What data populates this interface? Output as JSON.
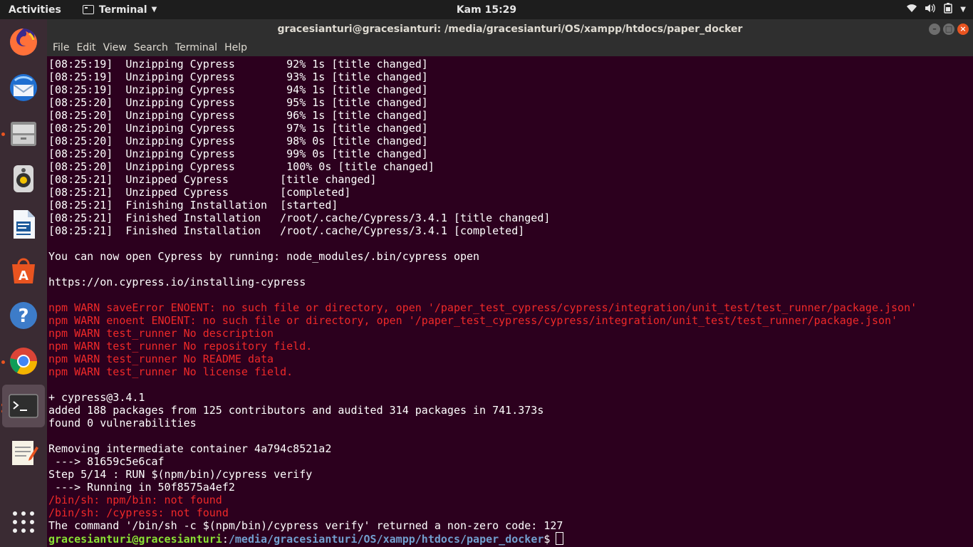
{
  "topbar": {
    "activities": "Activities",
    "app_name": "Terminal",
    "clock": "Kam 15:29"
  },
  "dock": {
    "items": [
      {
        "name": "Firefox",
        "icon": "firefox-icon"
      },
      {
        "name": "Thunderbird",
        "icon": "thunderbird-icon"
      },
      {
        "name": "Files",
        "icon": "files-icon"
      },
      {
        "name": "Rhythmbox",
        "icon": "rhythmbox-icon"
      },
      {
        "name": "LibreOffice Writer",
        "icon": "writer-icon"
      },
      {
        "name": "Ubuntu Software",
        "icon": "software-icon"
      },
      {
        "name": "Help",
        "icon": "help-icon"
      },
      {
        "name": "Chrome",
        "icon": "chrome-icon"
      },
      {
        "name": "Terminal",
        "icon": "terminal-icon"
      },
      {
        "name": "Text Editor",
        "icon": "text-editor-icon"
      },
      {
        "name": "Show Applications",
        "icon": "app-grid-icon"
      }
    ]
  },
  "window": {
    "title": "gracesianturi@gracesianturi: /media/gracesianturi/OS/xampp/htdocs/paper_docker"
  },
  "menu": [
    "File",
    "Edit",
    "View",
    "Search",
    "Terminal",
    "Help"
  ],
  "terminal": {
    "lines": [
      {
        "t": "[08:25:19]  Unzipping Cypress        92% 1s [title changed]"
      },
      {
        "t": "[08:25:19]  Unzipping Cypress        93% 1s [title changed]"
      },
      {
        "t": "[08:25:19]  Unzipping Cypress        94% 1s [title changed]"
      },
      {
        "t": "[08:25:20]  Unzipping Cypress        95% 1s [title changed]"
      },
      {
        "t": "[08:25:20]  Unzipping Cypress        96% 1s [title changed]"
      },
      {
        "t": "[08:25:20]  Unzipping Cypress        97% 1s [title changed]"
      },
      {
        "t": "[08:25:20]  Unzipping Cypress        98% 0s [title changed]"
      },
      {
        "t": "[08:25:20]  Unzipping Cypress        99% 0s [title changed]"
      },
      {
        "t": "[08:25:20]  Unzipping Cypress        100% 0s [title changed]"
      },
      {
        "t": "[08:25:21]  Unzipped Cypress        [title changed]"
      },
      {
        "t": "[08:25:21]  Unzipped Cypress        [completed]"
      },
      {
        "t": "[08:25:21]  Finishing Installation  [started]"
      },
      {
        "t": "[08:25:21]  Finished Installation   /root/.cache/Cypress/3.4.1 [title changed]"
      },
      {
        "t": "[08:25:21]  Finished Installation   /root/.cache/Cypress/3.4.1 [completed]"
      },
      {
        "t": ""
      },
      {
        "t": "You can now open Cypress by running: node_modules/.bin/cypress open"
      },
      {
        "t": ""
      },
      {
        "t": "https://on.cypress.io/installing-cypress"
      },
      {
        "t": ""
      },
      {
        "t": "npm WARN saveError ENOENT: no such file or directory, open '/paper_test_cypress/cypress/integration/unit_test/test_runner/package.json'",
        "err": true
      },
      {
        "t": "npm WARN enoent ENOENT: no such file or directory, open '/paper_test_cypress/cypress/integration/unit_test/test_runner/package.json'",
        "err": true
      },
      {
        "t": "npm WARN test_runner No description",
        "err": true
      },
      {
        "t": "npm WARN test_runner No repository field.",
        "err": true
      },
      {
        "t": "npm WARN test_runner No README data",
        "err": true
      },
      {
        "t": "npm WARN test_runner No license field.",
        "err": true
      },
      {
        "t": ""
      },
      {
        "t": "+ cypress@3.4.1"
      },
      {
        "t": "added 188 packages from 125 contributors and audited 314 packages in 741.373s"
      },
      {
        "t": "found 0 vulnerabilities"
      },
      {
        "t": ""
      },
      {
        "t": "Removing intermediate container 4a794c8521a2"
      },
      {
        "t": " ---> 81659c5e6caf"
      },
      {
        "t": "Step 5/14 : RUN $(npm/bin)/cypress verify"
      },
      {
        "t": " ---> Running in 50f8575a4ef2"
      },
      {
        "t": "/bin/sh: npm/bin: not found",
        "err": true
      },
      {
        "t": "/bin/sh: /cypress: not found",
        "err": true
      },
      {
        "t": "The command '/bin/sh -c $(npm/bin)/cypress verify' returned a non-zero code: 127"
      }
    ],
    "prompt": {
      "user": "gracesianturi@gracesianturi",
      "sep": ":",
      "path": "/media/gracesianturi/OS/xampp/htdocs/paper_docker",
      "symbol": "$"
    }
  },
  "colors": {
    "terminal_bg": "#2c001e",
    "error": "#ef2929",
    "prompt_user": "#8ae234",
    "prompt_path": "#729fcf",
    "accent": "#e95420"
  }
}
